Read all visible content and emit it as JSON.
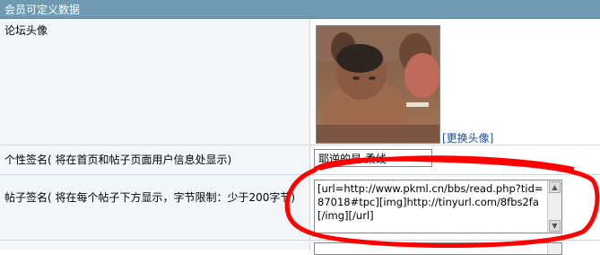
{
  "section_title": "会员可定义数据",
  "rows": {
    "avatar_label": "论坛头像",
    "change_avatar": "[更换头像]",
    "signature_label": "个性签名( 将在首页和帖子页面用户信息处显示)",
    "signature_value": "耶逆的是 柔线",
    "post_sig_label": "帖子签名( 将在每个帖子下方显示，字节限制：少于200字节)",
    "post_sig_value": "[url=http://www.pkml.cn/bbs/read.php?tid=87018#tpc][img]http://tinyurl.com/8fbs2fa[/img][/url]"
  },
  "colors": {
    "header_bg": "#6f9bb2",
    "label_bg": "#f2f6f9",
    "annotation": "#ff0000"
  }
}
